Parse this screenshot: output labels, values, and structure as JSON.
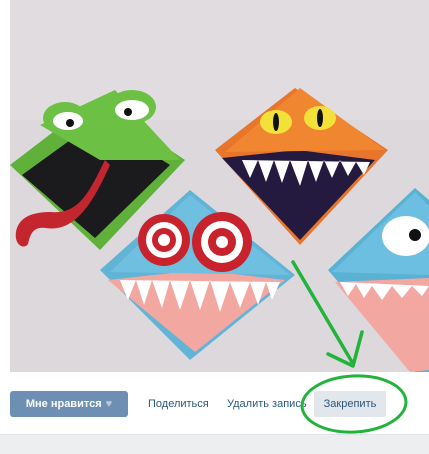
{
  "post": {
    "photo_alt": "origami-monsters-photo"
  },
  "actions": {
    "like_label": "Мне нравится",
    "like_icon": "heart-icon",
    "share_label": "Поделиться",
    "delete_label": "Удалить запись",
    "pin_label": "Закрепить"
  },
  "colors": {
    "like_button_bg": "#6d8fb3",
    "link_color": "#2b587a",
    "pin_button_bg": "#e1e7ed",
    "annotation_green": "#22b33b"
  }
}
